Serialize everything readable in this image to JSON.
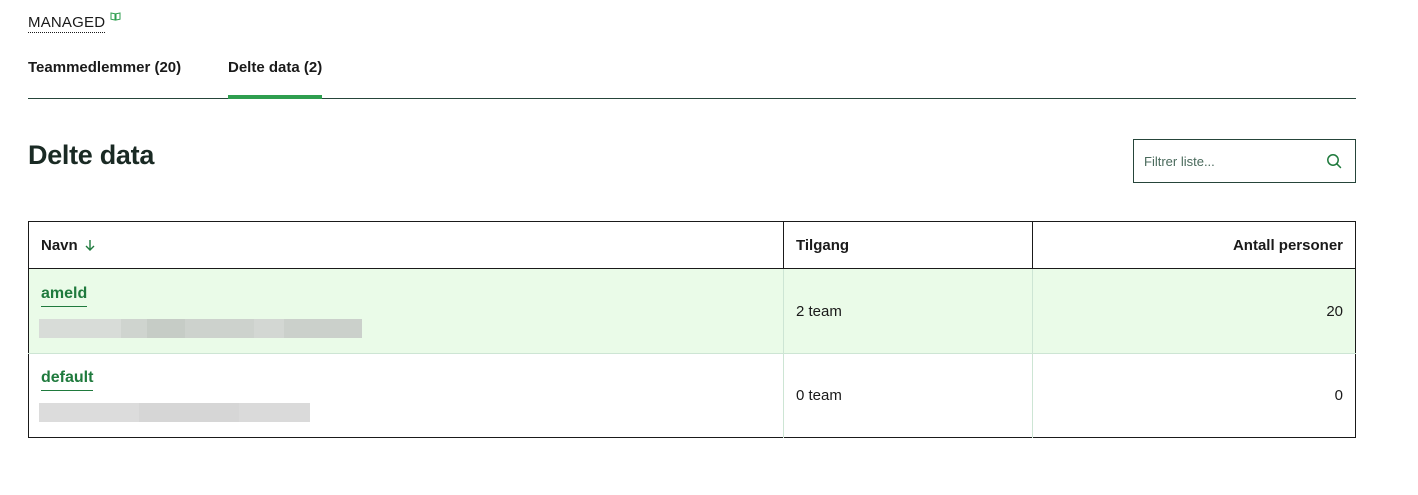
{
  "header": {
    "managed_label": "MANAGED",
    "managed_icon": "book-icon"
  },
  "tabs": [
    {
      "label": "Teammedlemmer (20)",
      "active": false
    },
    {
      "label": "Delte data (2)",
      "active": true
    }
  ],
  "page": {
    "title": "Delte data"
  },
  "search": {
    "placeholder": "Filtrer liste...",
    "value": "",
    "icon": "search-icon"
  },
  "table": {
    "columns": [
      {
        "label": "Navn",
        "sort": "desc"
      },
      {
        "label": "Tilgang"
      },
      {
        "label": "Antall personer"
      }
    ],
    "rows": [
      {
        "name": "ameld",
        "access": "2 team",
        "count": "20",
        "highlighted": true
      },
      {
        "name": "default",
        "access": "0 team",
        "count": "0",
        "highlighted": false
      }
    ]
  },
  "colors": {
    "accent": "#2e9e4f",
    "link": "#1f7a3d",
    "row_highlight": "#eafbe8",
    "border": "#26453a"
  }
}
